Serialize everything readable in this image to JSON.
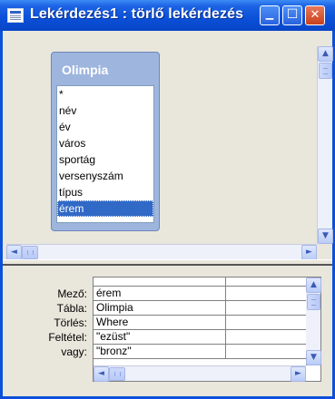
{
  "window": {
    "title": "Lekérdezés1 : törlő lekérdezés",
    "buttons": {
      "minimize": "▁",
      "maximize": "☐",
      "close": "✕"
    }
  },
  "table": {
    "name": "Olimpia",
    "fields": [
      "*",
      "név",
      "év",
      "város",
      "sportág",
      "versenyszám",
      "típus",
      "érem"
    ],
    "selected": "érem"
  },
  "grid": {
    "row_labels": [
      "Mező:",
      "Tábla:",
      "Törlés:",
      "Feltétel:",
      "vagy:"
    ],
    "columns": [
      {
        "values": [
          "érem",
          "Olimpia",
          "Where",
          "\"ezüst\"",
          "\"bronz\""
        ]
      },
      {
        "values": [
          "",
          "",
          "",
          "",
          ""
        ]
      }
    ]
  },
  "scroll": {
    "up": "▲",
    "down": "▼",
    "left": "◄",
    "right": "►"
  },
  "colors": {
    "title_bar": "#0a50d8",
    "selection": "#3169c6",
    "table_header": "#9eb5de"
  }
}
